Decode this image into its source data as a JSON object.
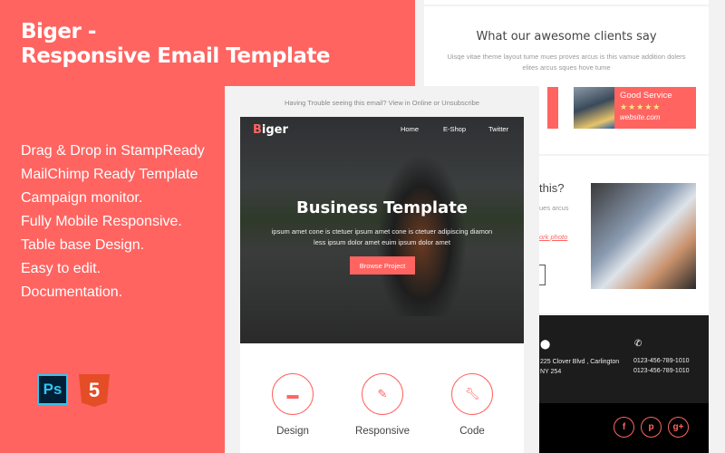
{
  "promo": {
    "title_line1": "Biger -",
    "title_line2": "Responsive Email Template",
    "features": [
      "Drag & Drop in StampReady",
      "MailChimp Ready Template",
      "Campaign monitor.",
      "Fully Mobile Responsive.",
      "Table base Design.",
      "Easy to edit.",
      "Documentation."
    ],
    "tools": {
      "photoshop": "Ps",
      "html5": "5"
    }
  },
  "back": {
    "clients_title": "What our awesome clients say",
    "clients_text": "Uisqe vitae theme layout tume mues proves arcus is this vamue addition dolers elites arcus sques hove tume",
    "testimonial": {
      "title": "Good Service",
      "stars": "★★★★★",
      "rating": 5,
      "site": "website.com"
    },
    "question": "this?",
    "question_text": "ues arcus",
    "link": "ork photo",
    "footer": {
      "address_line1": "225 Clover Blvd , Carlington",
      "address_line2": "NY 254",
      "phone1": "0123-456-789-1010",
      "phone2": "0123-456-789-1010"
    },
    "social": [
      "f",
      "p",
      "g+"
    ]
  },
  "email": {
    "trouble": "Having Trouble seeing this email? View in Online or Unsubscribe",
    "logo_first": "B",
    "logo_rest": "iger",
    "nav": [
      "Home",
      "E-Shop",
      "Twitter"
    ],
    "hero_title": "Business Template",
    "hero_line1": "ipsum amet cone is ctetuer ipsum amet cone is ctetuer adipiscing diamon",
    "hero_line2": "less ipsum dolor amet euim ipsum dolor amet",
    "cta": "Browse Project",
    "services": [
      "Design",
      "Responsive",
      "Code"
    ]
  },
  "colors": {
    "accent": "#ff6461",
    "dark": "#1c1c1c"
  }
}
